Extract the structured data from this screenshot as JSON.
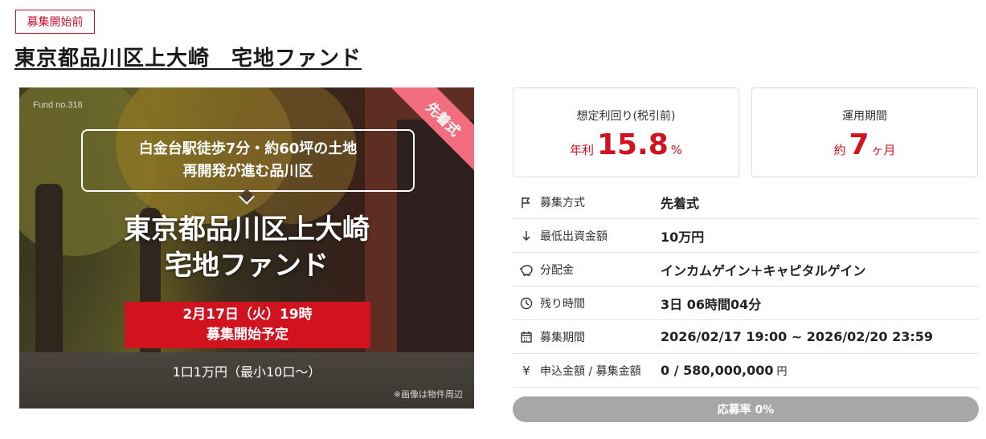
{
  "status_badge": "募集開始前",
  "title": "東京都品川区上大崎　宅地ファンド",
  "banner": {
    "fund_no": "Fund no.318",
    "ribbon": "先着式",
    "callout_line1": "白金台駅徒歩7分・約60坪の土地",
    "callout_line2": "再開発が進む品川区",
    "title_line1": "東京都品川区上大崎",
    "title_line2": "宅地ファンド",
    "date_line1": "2月17日（火）19時",
    "date_line2": "募集開始予定",
    "min_invest": "1口1万円（最小10口～）",
    "note": "※画像は物件周辺"
  },
  "yield_card": {
    "label": "想定利回り(税引前)",
    "prefix": "年利",
    "value": "15.8",
    "suffix": "%"
  },
  "term_card": {
    "label": "運用期間",
    "prefix": "約",
    "value": "7",
    "suffix": "ヶ月"
  },
  "details": [
    {
      "icon": "flag-icon",
      "label": "募集方式",
      "value": "先着式"
    },
    {
      "icon": "arrow-down-icon",
      "label": "最低出資金額",
      "value": "10万円"
    },
    {
      "icon": "piggy-bank-icon",
      "label": "分配金",
      "value": "インカムゲイン＋キャピタルゲイン"
    },
    {
      "icon": "clock-icon",
      "label": "残り時間",
      "value": "3日 06時間04分"
    },
    {
      "icon": "calendar-icon",
      "label": "募集期間",
      "value": "2026/02/17 19:00 ~ 2026/02/20 23:59"
    },
    {
      "icon": "yen-icon",
      "label": "申込金額 / 募集金額",
      "value": "0 / 580,000,000",
      "unit": "円"
    }
  ],
  "progress": {
    "label": "応募率 0%",
    "rate": 0
  },
  "colors": {
    "accent": "#d1121f",
    "badge": "#c8102e",
    "progress_bg": "#a7a7a7"
  }
}
